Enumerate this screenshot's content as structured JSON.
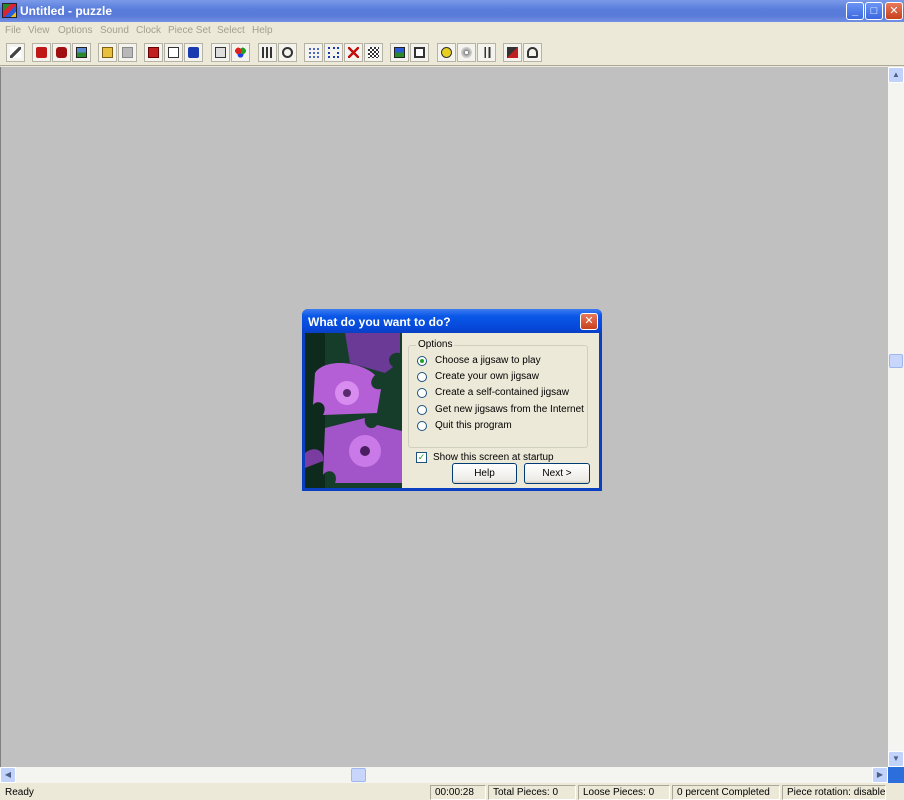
{
  "window": {
    "title": "Untitled - puzzle",
    "minimize": "_",
    "maximize": "□",
    "close": "✕"
  },
  "menu": [
    "File",
    "View",
    "Options",
    "Sound",
    "Clock",
    "Piece Set",
    "Select",
    "Help"
  ],
  "toolbar": {
    "icons": [
      "wand-icon",
      "puzzle-red-icon",
      "puzzle-split-icon",
      "picture-icon",
      "open-folder-icon",
      "save-icon",
      "gift-icon",
      "mail-icon",
      "info-icon",
      "properties-icon",
      "colors-icon",
      "scatter-icon",
      "clock-icon",
      "grid-dots-icon",
      "grid-border-icon",
      "delete-icon",
      "shuffle-icon",
      "image-preview-icon",
      "fit-view-icon",
      "sound-icon",
      "cd-icon",
      "music-icon",
      "layers-icon",
      "help-icon"
    ]
  },
  "dialog": {
    "title": "What do you want to do?",
    "close": "✕",
    "group_label": "Options",
    "options": [
      {
        "label": "Choose a jigsaw to play",
        "selected": true
      },
      {
        "label": "Create your own jigsaw",
        "selected": false
      },
      {
        "label": "Create a self-contained jigsaw",
        "selected": false
      },
      {
        "label": "Get new jigsaws from the Internet",
        "selected": false
      },
      {
        "label": "Quit this program",
        "selected": false
      }
    ],
    "checkbox_label": "Show this screen at startup",
    "checkbox_checked": true,
    "checkbox_mark": "✓",
    "help_label": "Help",
    "next_label": "Next >"
  },
  "scrollbars": {
    "up": "▲",
    "down": "▼",
    "left": "◀",
    "right": "▶"
  },
  "status": {
    "ready": "Ready",
    "time": "00:00:28",
    "total_pieces": "Total Pieces: 0",
    "loose_pieces": "Loose Pieces: 0",
    "percent": "0 percent Completed",
    "rotation": "Piece rotation: disabled"
  }
}
